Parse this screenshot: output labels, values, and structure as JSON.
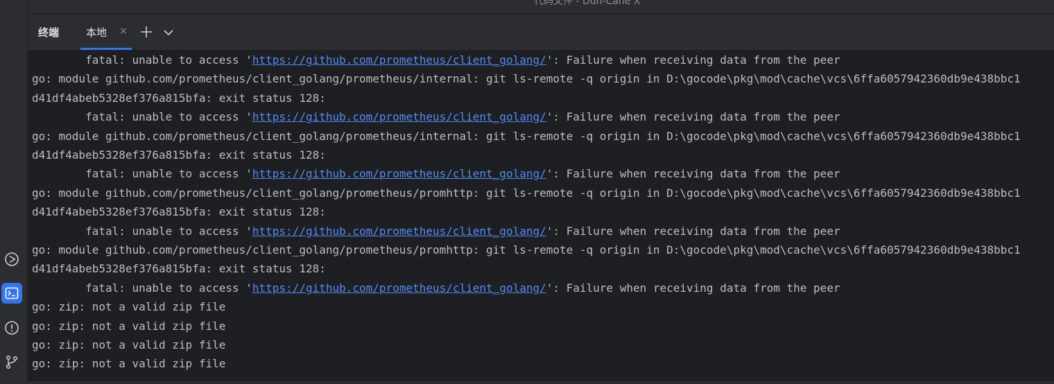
{
  "window": {
    "title": "代码文件 - Dun-Cane X"
  },
  "left_bar": {
    "icons": [
      "run-icon",
      "terminal-icon",
      "problems-icon",
      "git-icon"
    ],
    "active": "terminal-icon",
    "accent": "#3574f0"
  },
  "toolwindow": {
    "title": "终端",
    "tabs": [
      {
        "label": "本地",
        "close": "×"
      }
    ],
    "add_tab_icon": "plus-icon",
    "dropdown_icon": "chevron-down-icon"
  },
  "terminal": {
    "link_color": "#548af7",
    "text_color": "#bcbec4",
    "lines": [
      {
        "pre": "        fatal: unable to access '",
        "link": "https://github.com/prometheus/client_golang/",
        "post": "': Failure when receiving data from the peer"
      },
      {
        "pre": "go: module github.com/prometheus/client_golang/prometheus/internal: git ls-remote -q origin in D:\\gocode\\pkg\\mod\\cache\\vcs\\6ffa6057942360db9e438bbc1"
      },
      {
        "pre": "d41df4abeb5328ef376a815bfa: exit status 128:"
      },
      {
        "pre": "        fatal: unable to access '",
        "link": "https://github.com/prometheus/client_golang/",
        "post": "': Failure when receiving data from the peer"
      },
      {
        "pre": "go: module github.com/prometheus/client_golang/prometheus/internal: git ls-remote -q origin in D:\\gocode\\pkg\\mod\\cache\\vcs\\6ffa6057942360db9e438bbc1"
      },
      {
        "pre": "d41df4abeb5328ef376a815bfa: exit status 128:"
      },
      {
        "pre": "        fatal: unable to access '",
        "link": "https://github.com/prometheus/client_golang/",
        "post": "': Failure when receiving data from the peer"
      },
      {
        "pre": "go: module github.com/prometheus/client_golang/prometheus/promhttp: git ls-remote -q origin in D:\\gocode\\pkg\\mod\\cache\\vcs\\6ffa6057942360db9e438bbc1"
      },
      {
        "pre": "d41df4abeb5328ef376a815bfa: exit status 128:"
      },
      {
        "pre": "        fatal: unable to access '",
        "link": "https://github.com/prometheus/client_golang/",
        "post": "': Failure when receiving data from the peer"
      },
      {
        "pre": "go: module github.com/prometheus/client_golang/prometheus/promhttp: git ls-remote -q origin in D:\\gocode\\pkg\\mod\\cache\\vcs\\6ffa6057942360db9e438bbc1"
      },
      {
        "pre": "d41df4abeb5328ef376a815bfa: exit status 128:"
      },
      {
        "pre": "        fatal: unable to access '",
        "link": "https://github.com/prometheus/client_golang/",
        "post": "': Failure when receiving data from the peer"
      },
      {
        "pre": "go: zip: not a valid zip file"
      },
      {
        "pre": "go: zip: not a valid zip file"
      },
      {
        "pre": "go: zip: not a valid zip file"
      },
      {
        "pre": "go: zip: not a valid zip file"
      }
    ]
  }
}
